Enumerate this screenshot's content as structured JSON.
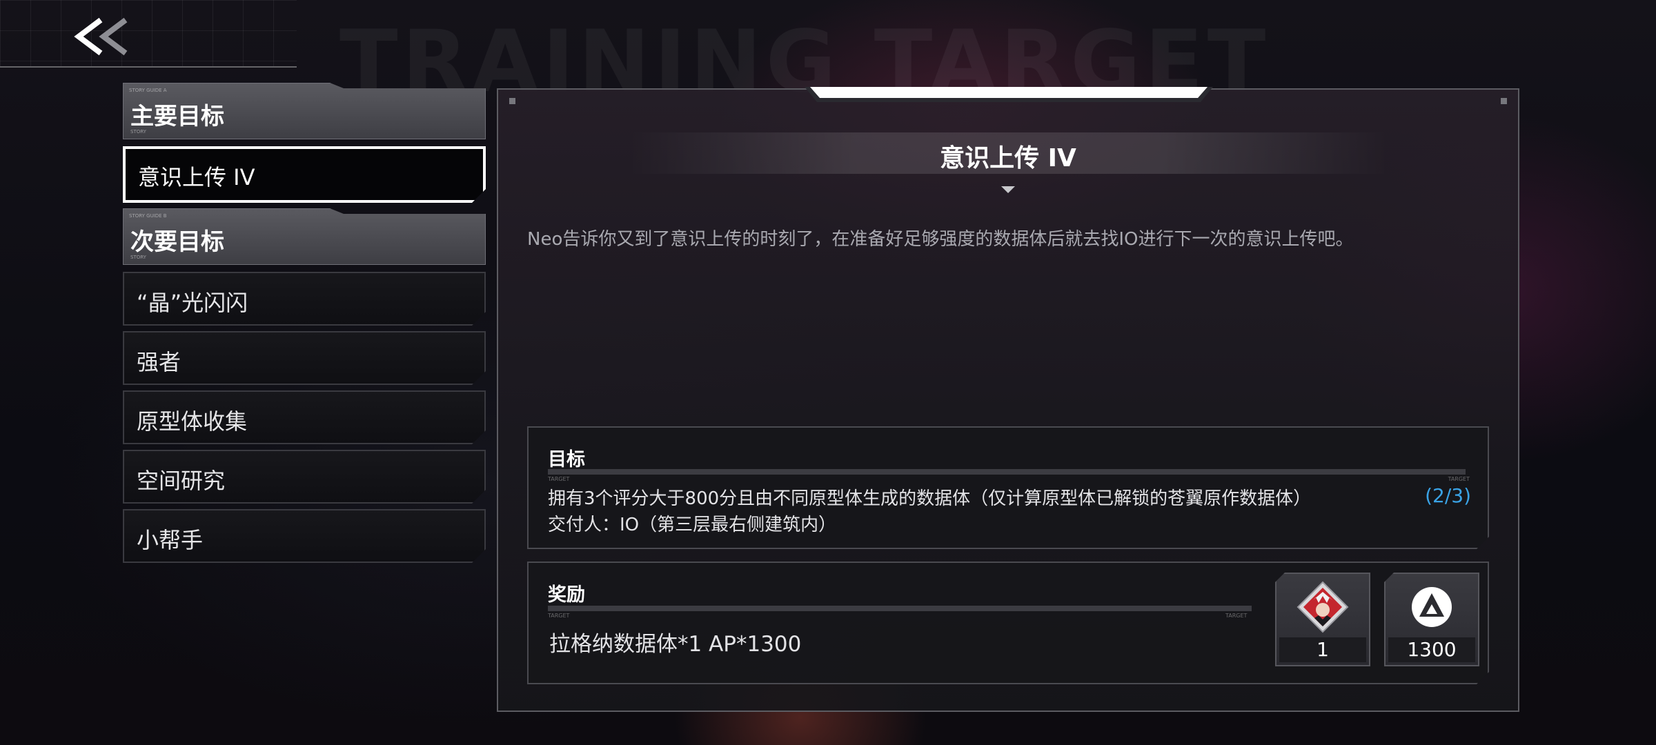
{
  "header": {
    "back_label": "<<",
    "watermark": "TRAINING TARGET"
  },
  "menu": {
    "main_section": {
      "label": "主要目标",
      "tiny_top": "STORY GUIDE A",
      "tiny_bottom": "STORY"
    },
    "main_items": [
      {
        "label": "意识上传 IV",
        "selected": true
      }
    ],
    "side_section": {
      "label": "次要目标",
      "tiny_top": "STORY GUIDE B",
      "tiny_bottom": "STORY"
    },
    "side_items": [
      {
        "label": "“晶”光闪闪"
      },
      {
        "label": "强者"
      },
      {
        "label": "原型体收集"
      },
      {
        "label": "空间研究"
      },
      {
        "label": "小帮手"
      }
    ]
  },
  "quest": {
    "title": "意识上传 IV",
    "description": "Neo告诉你又到了意识上传的时刻了，在准备好足够强度的数据体后就去找IO进行下一次的意识上传吧。",
    "target": {
      "heading": "目标",
      "tiny_label": "TARGET",
      "tiny_label_right": "TARGET",
      "line1": "拥有3个评分大于800分且由不同原型体生成的数据体（仅计算原型体已解锁的苍翼原作数据体）",
      "progress": "(2/3)",
      "line2": "交付人：IO（第三层最右侧建筑内）"
    },
    "reward": {
      "heading": "奖励",
      "tiny_label": "TARGET",
      "tiny_label_right": "TARGET",
      "text": "拉格纳数据体*1  AP*1300",
      "items": [
        {
          "icon": "ragna-data-icon",
          "count": "1"
        },
        {
          "icon": "ap-icon",
          "count": "1300"
        }
      ]
    }
  },
  "colors": {
    "progress": "#3aa3e6",
    "selected_border": "#ffffff",
    "ragna_red": "#c4262e"
  }
}
